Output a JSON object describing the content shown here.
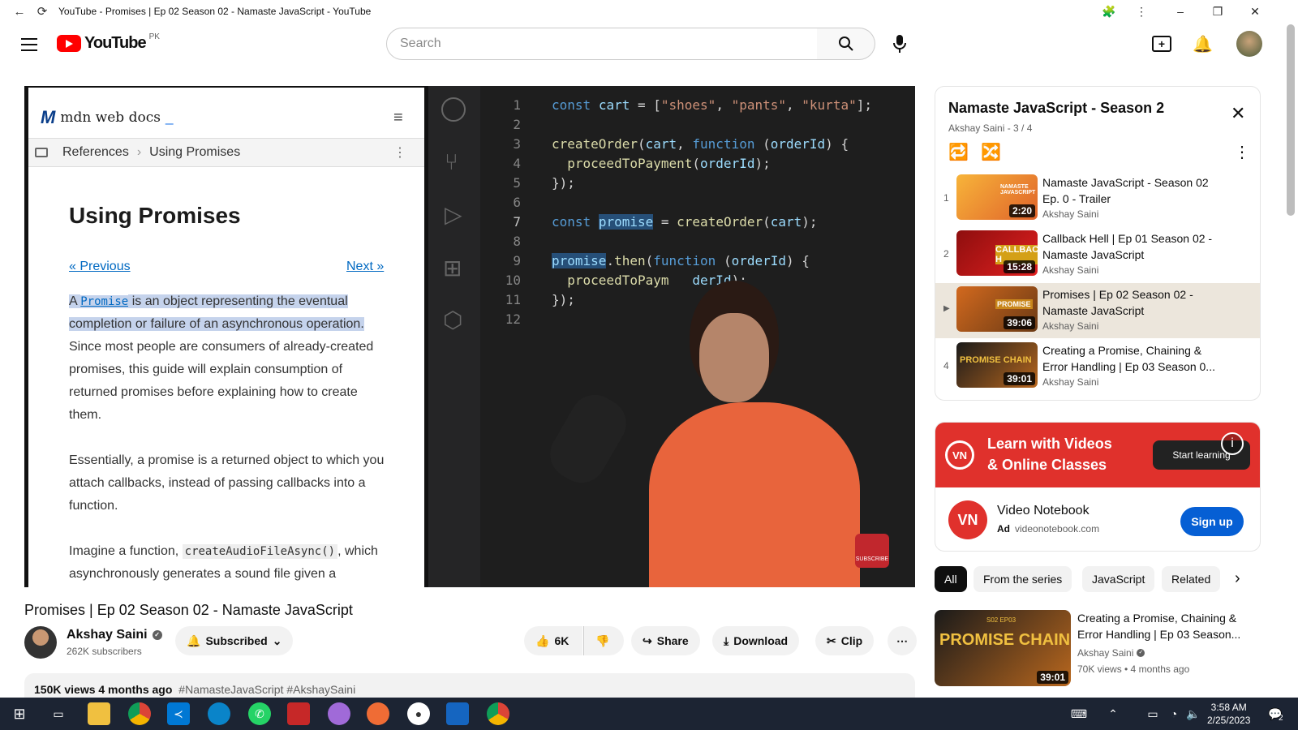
{
  "window": {
    "title": "YouTube - Promises | Ep 02 Season 02 - Namaste JavaScript - YouTube"
  },
  "header": {
    "logo_text": "YouTube",
    "region": "PK",
    "search_placeholder": "Search"
  },
  "player": {
    "mdn": {
      "brand": "mdn web docs",
      "breadcrumb_1": "References",
      "breadcrumb_2": "Using Promises",
      "heading": "Using Promises",
      "prev": "« Previous",
      "next": "Next »",
      "p1_a": "A ",
      "p1_code": "Promise",
      "p1_b": " is an object representing the eventual completion or failure of an asynchronous operation.",
      "p1_rest": "Since most people are consumers of already-created promises, this guide will explain consumption of returned promises before explaining how to create them.",
      "p2": "Essentially, a promise is a returned object to which you attach callbacks, instead of passing callbacks into a function.",
      "p3_a": "Imagine a function, ",
      "p3_code": "createAudioFileAsync()",
      "p3_b": ",",
      "p3_c": "which asynchronously generates a sound file given a"
    },
    "code_lines": [
      "1",
      "2",
      "3",
      "4",
      "5",
      "6",
      "7",
      "8",
      "9",
      "10",
      "11",
      "12"
    ]
  },
  "video": {
    "title": "Promises | Ep 02 Season 02 - Namaste JavaScript",
    "channel": "Akshay Saini",
    "subscribers": "262K subscribers",
    "subscribed_label": "Subscribed",
    "likes": "6K",
    "share": "Share",
    "download": "Download",
    "clip": "Clip",
    "views_line": "150K views  4 months ago",
    "hashtags": "#NamasteJavaScript #AkshaySaini"
  },
  "playlist": {
    "title": "Namaste JavaScript - Season 2",
    "meta": "Akshay Saini - 3 / 4",
    "items": [
      {
        "idx": "1",
        "title": "Namaste JavaScript - Season 02 Ep. 0 - Trailer",
        "channel": "Akshay Saini",
        "duration": "2:20",
        "thumb_text": "NAMASTE JAVASCRIPT"
      },
      {
        "idx": "2",
        "title": "Callback Hell | Ep 01 Season 02 - Namaste JavaScript",
        "channel": "Akshay Saini",
        "duration": "15:28",
        "thumb_text": "CALLBACK H"
      },
      {
        "idx": "▶",
        "title": "Promises | Ep 02 Season 02 - Namaste JavaScript",
        "channel": "Akshay Saini",
        "duration": "39:06",
        "thumb_text": "PROMISE"
      },
      {
        "idx": "4",
        "title": "Creating a Promise, Chaining & Error Handling | Ep 03 Season 0...",
        "channel": "Akshay Saini",
        "duration": "39:01",
        "thumb_text": "PROMISE CHAIN"
      }
    ]
  },
  "ad": {
    "banner_line1": "Learn with Videos",
    "banner_line2": "& Online Classes",
    "banner_cta": "Start learning",
    "logo": "VN",
    "name": "Video Notebook",
    "ad_badge": "Ad",
    "domain": "videonotebook.com",
    "signup": "Sign up"
  },
  "chips": [
    "All",
    "From the series",
    "JavaScript",
    "Related"
  ],
  "recommended": [
    {
      "title": "Creating a Promise, Chaining & Error Handling | Ep 03 Season...",
      "channel": "Akshay Saini",
      "meta": "70K views  •  4 months ago",
      "duration": "39:01",
      "thumb_text": "PROMISE CHAIN",
      "badge": "S02 EP03"
    }
  ],
  "taskbar": {
    "time": "3:58 AM",
    "date": "2/25/2023",
    "notif_count": "2"
  },
  "colors": {
    "youtube_red": "#ff0000",
    "accent_blue": "#065fd4",
    "ad_red": "#e0312c"
  }
}
